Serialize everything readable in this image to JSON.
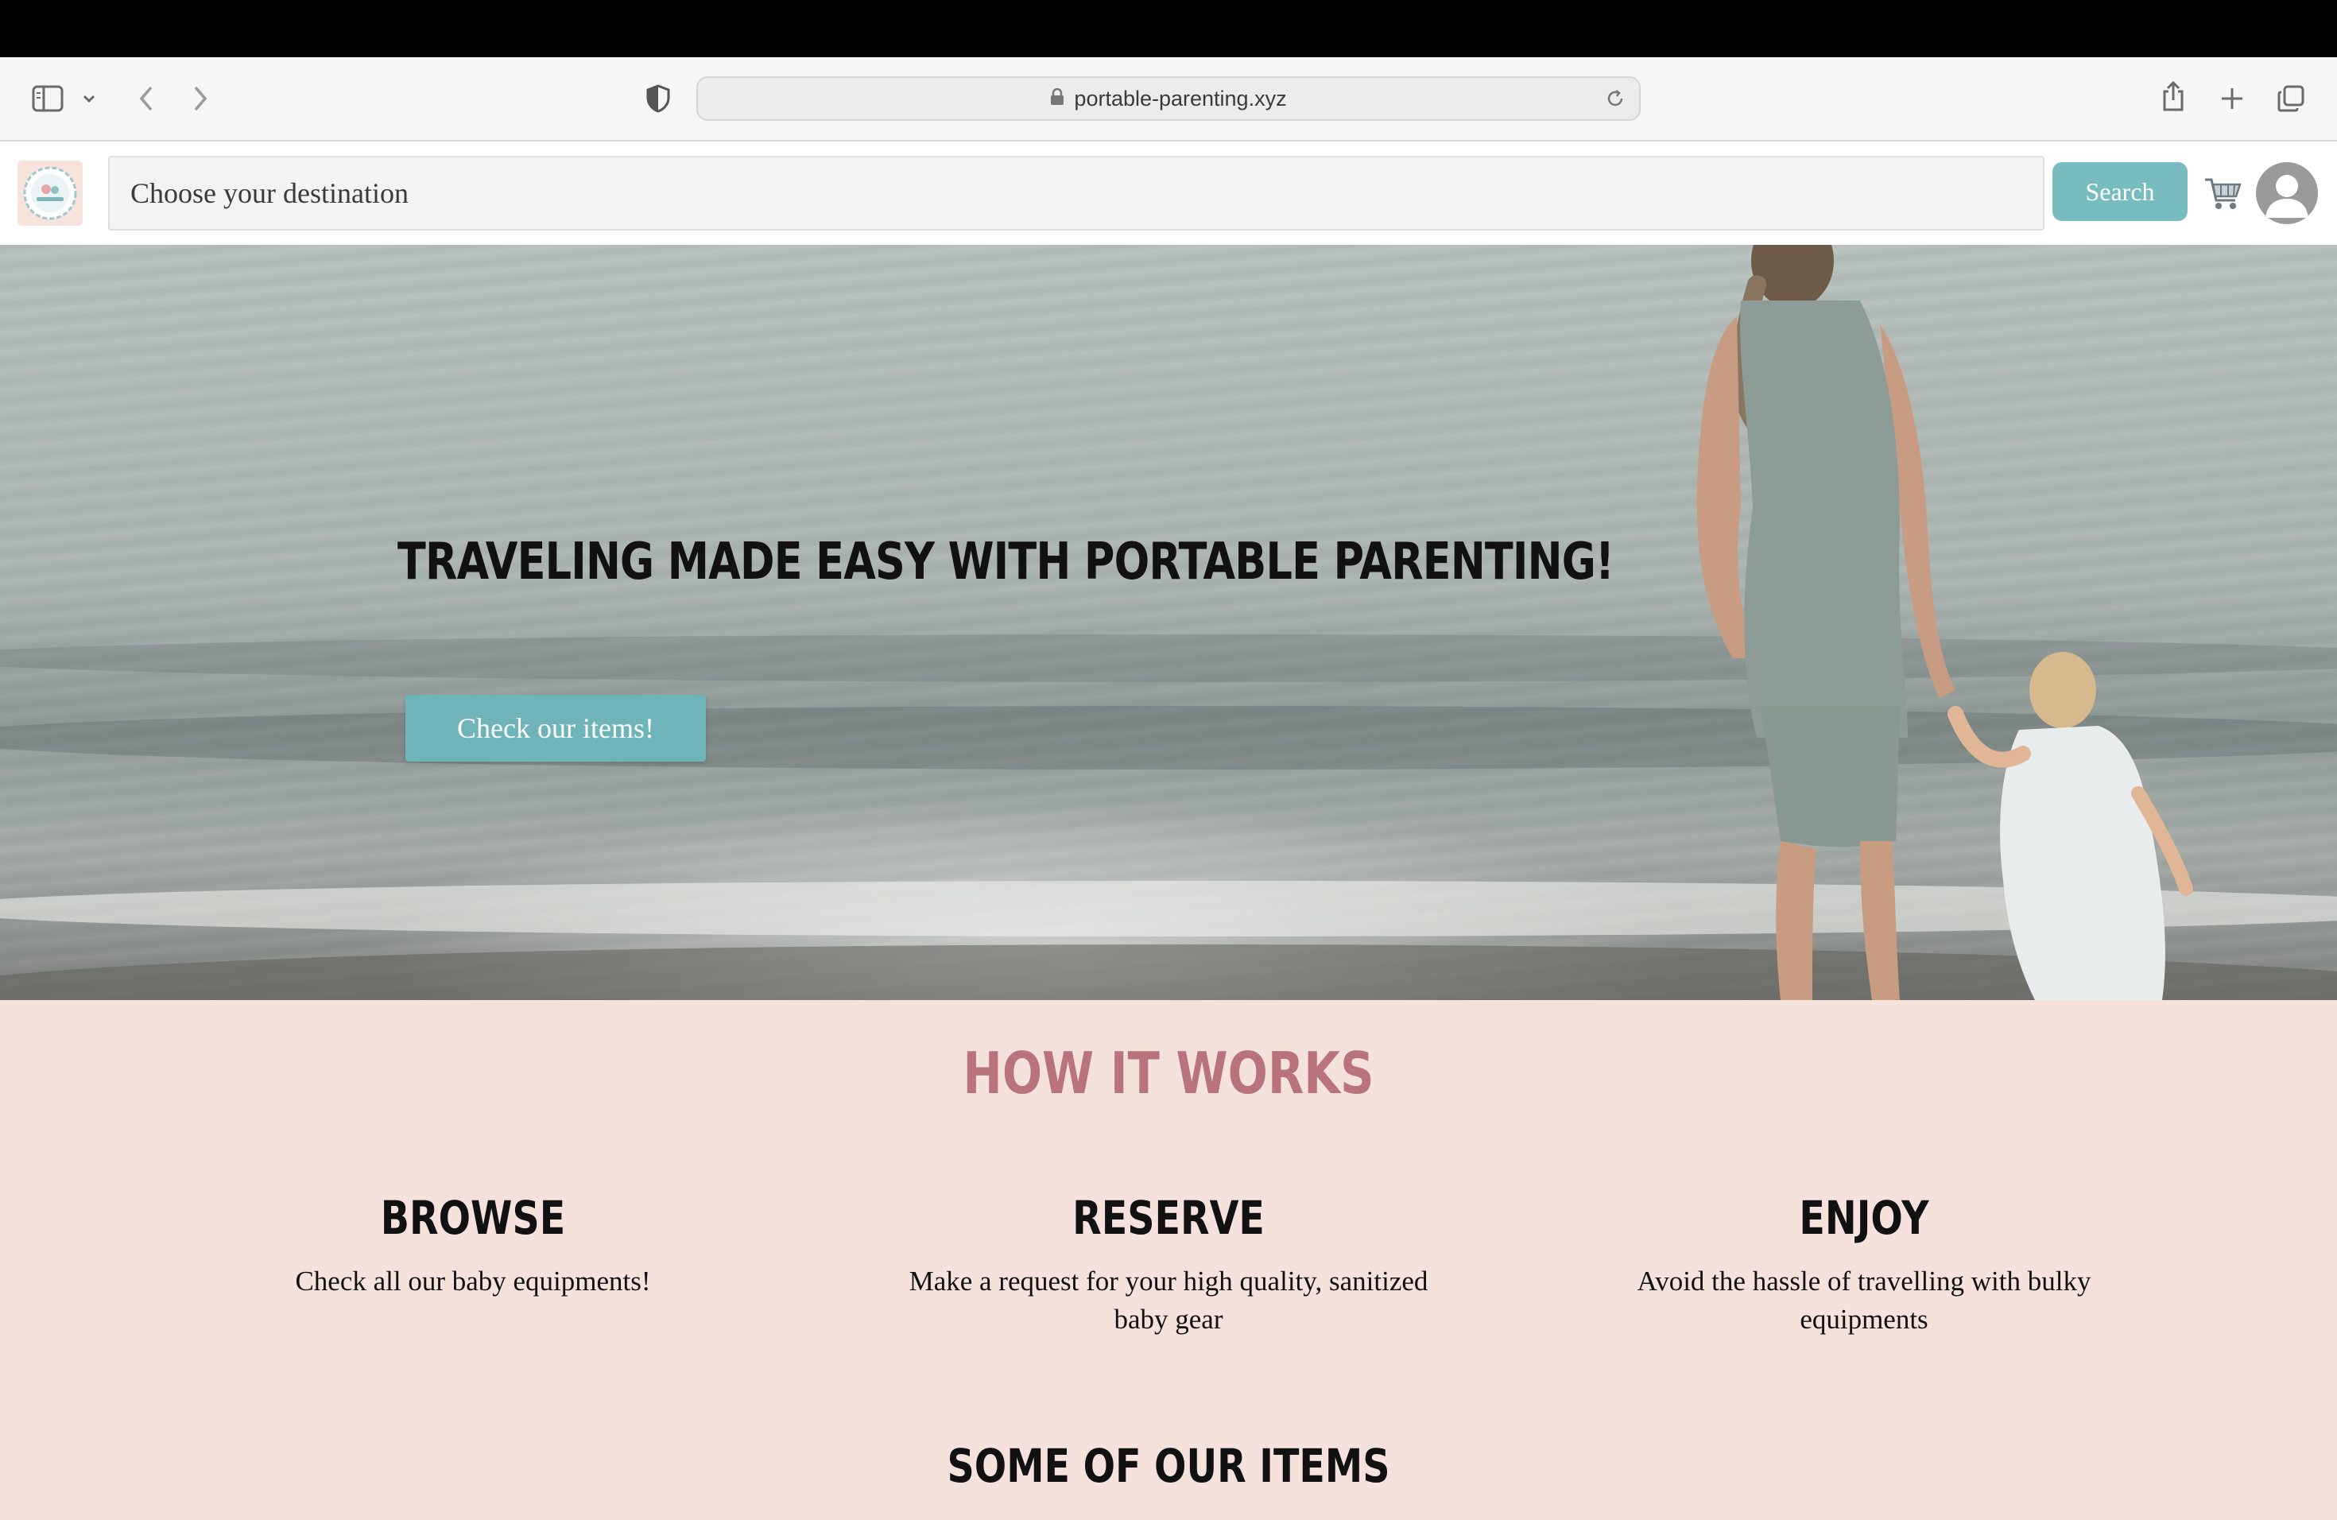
{
  "browser": {
    "url": "portable-parenting.xyz"
  },
  "header": {
    "search_placeholder": "Choose your destination",
    "search_label": "Search"
  },
  "hero": {
    "title": "TRAVELING MADE EASY WITH PORTABLE PARENTING!",
    "cta_label": "Check our items!"
  },
  "how_it_works": {
    "title": "HOW IT WORKS",
    "steps": [
      {
        "title": "BROWSE",
        "text": "Check all our baby equipments!"
      },
      {
        "title": "RESERVE",
        "text": "Make a request for your high quality, sanitized baby gear"
      },
      {
        "title": "ENJOY",
        "text": "Avoid the hassle of travelling with bulky equipments"
      }
    ]
  },
  "items": {
    "title": "SOME OF OUR ITEMS"
  },
  "colors": {
    "accent": "#78bcc0",
    "section_bg": "#f5e2dc",
    "section_title": "#b8747a"
  }
}
